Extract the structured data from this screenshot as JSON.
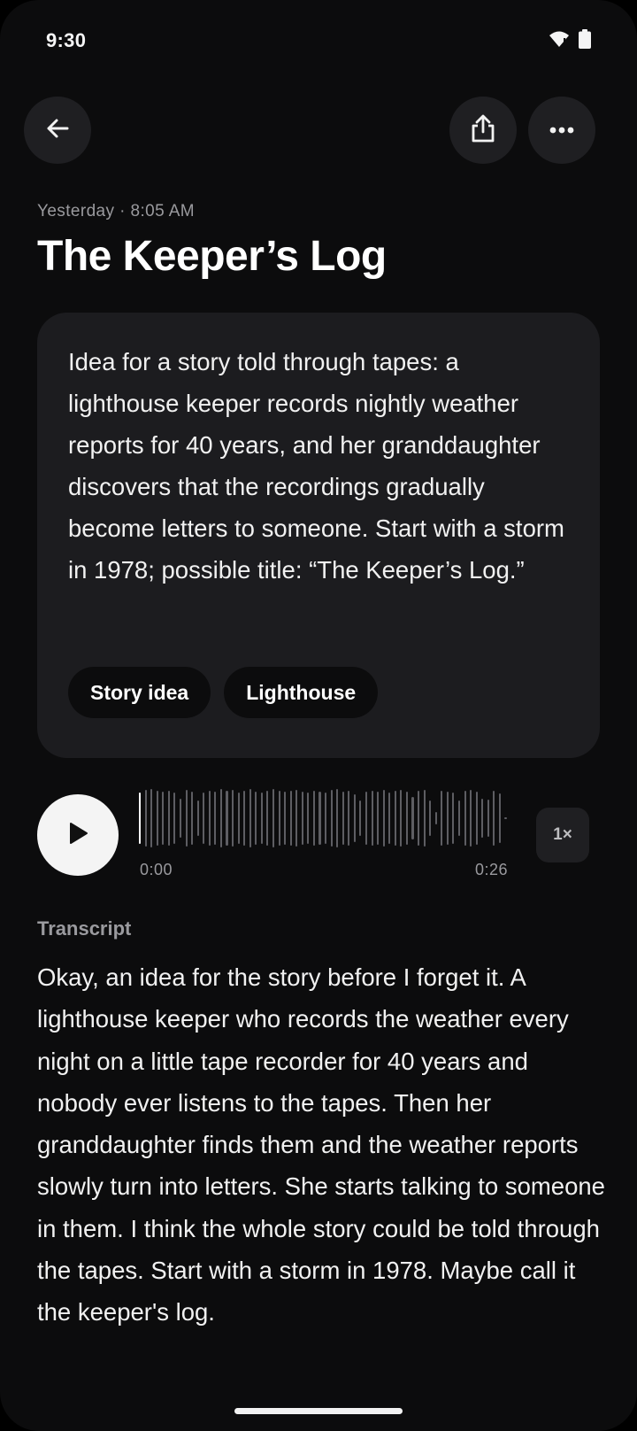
{
  "status_bar": {
    "time": "9:30",
    "icons": [
      "wifi-icon",
      "battery-icon"
    ]
  },
  "toolbar": {
    "back_icon": "arrow-left-icon",
    "share_icon": "share-icon",
    "more_icon": "more-horizontal-icon"
  },
  "note": {
    "date": "Yesterday · 8:05 AM",
    "title": "The Keeper’s Log",
    "summary": "Idea for a story told through tapes: a lighthouse keeper records nightly weather reports for 40 years, and her granddaughter discovers that the recordings gradually become letters to someone. Start with a storm in 1978; possible title: “The Keeper’s Log.”",
    "tags": [
      "Story idea",
      "Lighthouse"
    ]
  },
  "player": {
    "play_icon": "play-icon",
    "current_time": "0:00",
    "duration": "0:26",
    "progress": 0,
    "speed_label": "1×"
  },
  "transcript": {
    "heading": "Transcript",
    "text": "Okay, an idea for the story before I forget it. A lighthouse keeper who records the weather every night on a little tape recorder for 40 years and nobody ever listens to the tapes. Then her granddaughter finds them and the weather reports slowly turn into letters. She starts talking to someone in them. I think the whole story could be told through the tapes. Start with a storm in 1978. Maybe call it the keeper's log."
  },
  "colors": {
    "background": "#0c0c0d",
    "card": "#1c1c1f",
    "button": "#1f1f22",
    "waveform": "#5e5e63",
    "text": "#f1f1f1",
    "muted": "#9a9a9e"
  }
}
